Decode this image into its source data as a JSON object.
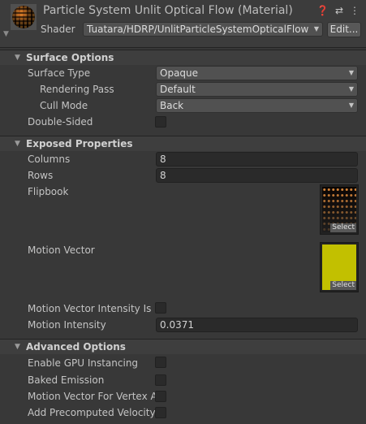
{
  "header": {
    "title": "Particle System Unlit Optical Flow (Material)",
    "shader_label": "Shader",
    "shader_value": "Tuatara/HDRP/UnlitParticleSystemOpticalFlow",
    "edit_label": "Edit...",
    "icons": [
      "help-icon",
      "presets-icon",
      "more-icon"
    ]
  },
  "surface": {
    "title": "Surface Options",
    "surface_type_label": "Surface Type",
    "surface_type": "Opaque",
    "rendering_pass_label": "Rendering Pass",
    "rendering_pass": "Default",
    "cull_mode_label": "Cull Mode",
    "cull_mode": "Back",
    "double_sided_label": "Double-Sided",
    "double_sided": false
  },
  "exposed": {
    "title": "Exposed Properties",
    "columns_label": "Columns",
    "columns": "8",
    "rows_label": "Rows",
    "rows": "8",
    "flipbook_label": "Flipbook",
    "motion_vector_label": "Motion Vector",
    "select_label": "Select",
    "mv_intensity_enabled_label": "Motion Vector Intensity Is Er",
    "mv_intensity_enabled": false,
    "motion_intensity_label": "Motion Intensity",
    "motion_intensity": "0.0371"
  },
  "advanced": {
    "title": "Advanced Options",
    "gpu_instancing_label": "Enable GPU Instancing",
    "baked_emission_label": "Baked Emission",
    "mv_vertex_label": "Motion Vector For Vertex Ar",
    "precomputed_velocity_label": "Add Precomputed Velocity"
  },
  "colors": {
    "motion_vector_texture": "#c2c000",
    "background": "#383838"
  }
}
